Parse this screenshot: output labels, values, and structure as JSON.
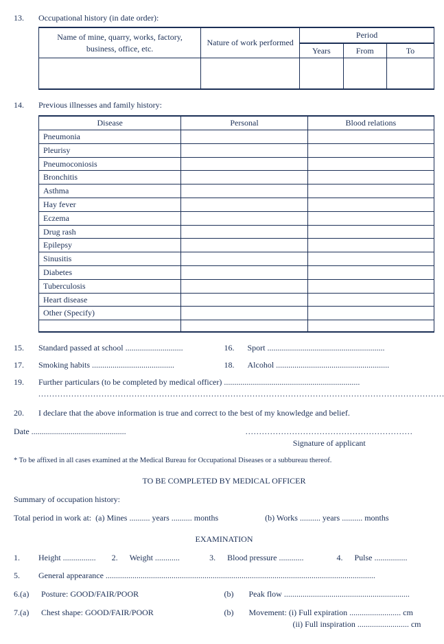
{
  "q13": {
    "num": "13.",
    "label": "Occupational history (in date order):"
  },
  "occ_table": {
    "h_name": "Name of mine, quarry, works, factory, business, office, etc.",
    "h_nature": "Nature of work performed",
    "h_period": "Period",
    "h_years": "Years",
    "h_from": "From",
    "h_to": "To"
  },
  "q14": {
    "num": "14.",
    "label": "Previous illnesses and family history:"
  },
  "dis_table": {
    "h_disease": "Disease",
    "h_personal": "Personal",
    "h_blood": "Blood relations",
    "rows": [
      "Pneumonia",
      "Pleurisy",
      "Pneumoconiosis",
      "Bronchitis",
      "Asthma",
      "Hay fever",
      "Eczema",
      "Drug rash",
      "Epilepsy",
      "Sinusitis",
      "Diabetes",
      "Tuberculosis",
      "Heart disease",
      "Other (Specify)"
    ]
  },
  "q15": {
    "num": "15.",
    "label": "Standard passed at school ............................"
  },
  "q16": {
    "num": "16.",
    "label": "Sport ........................................................."
  },
  "q17": {
    "num": "17.",
    "label": "Smoking habits ........................................"
  },
  "q18": {
    "num": "18.",
    "label": "Alcohol ......................................................."
  },
  "q19": {
    "num": "19.",
    "label": "Further particulars (to be completed by medical officer) ..................................................................",
    "line2": "........................................................................................................................................................................"
  },
  "q20": {
    "num": "20.",
    "label": "I declare that the above information is true and correct to the best of my knowledge and belief."
  },
  "date_line": "Date ..............................................",
  "sig_dots": ".............................................................",
  "sig_label": "Signature of applicant",
  "footnote": "*  To be affixed in all cases examined at the Medical Bureau for Occupational Diseases or a subbureau thereof.",
  "med_head": "TO BE COMPLETED BY MEDICAL OFFICER",
  "summary_label": "Summary of occupation history:",
  "total_line": {
    "pre": "Total period in work at:",
    "a": "(a)  Mines .......... years .......... months",
    "b": "(b)  Works .......... years .......... months"
  },
  "exam_head": "EXAMINATION",
  "e1": {
    "n": "1.",
    "l": "Height ................"
  },
  "e2": {
    "n": "2.",
    "l": "Weight ............"
  },
  "e3": {
    "n": "3.",
    "l": "Blood pressure ............"
  },
  "e4": {
    "n": "4.",
    "l": "Pulse ................"
  },
  "e5": {
    "n": "5.",
    "l": "General appearance ..................................................................................................................................."
  },
  "e6a": {
    "n": "6.(a)",
    "l": "Posture:  GOOD/FAIR/POOR"
  },
  "e6b": {
    "n": "(b)",
    "l": "Peak flow ............................................................."
  },
  "e7a": {
    "n": "7.(a)",
    "l": "Chest shape:  GOOD/FAIR/POOR"
  },
  "e7b": {
    "n": "(b)",
    "l1": "Movement:  (i)     Full expiration ......................... cm",
    "l2": "(ii)    Full inspiration ......................... cm"
  }
}
